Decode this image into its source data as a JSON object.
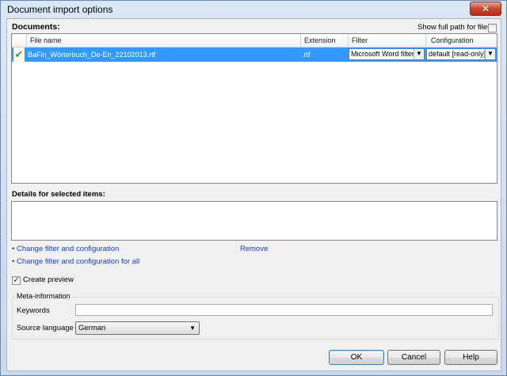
{
  "window": {
    "title": "Document import options",
    "close_glyph": "✕"
  },
  "documents": {
    "heading": "Documents:",
    "show_full_path_label": "Show full path for files",
    "show_full_path_checked": false,
    "columns": [
      "File name",
      "Extension",
      "Filter",
      "Configuration"
    ],
    "rows": [
      {
        "status_icon": "check-icon",
        "status_glyph": "✔",
        "file_name": "BaFin_Wörterbuch_De-En_22102013.rtf",
        "extension": ".rtf",
        "filter": "Microsoft Word filter",
        "configuration": "default [read-only]"
      }
    ]
  },
  "details": {
    "heading": "Details for selected items:"
  },
  "links": {
    "change_filter": "• Change filter and configuration",
    "remove": "Remove",
    "change_filter_all": "• Change filter and configuration for all"
  },
  "preview": {
    "label": "Create preview",
    "checked": true
  },
  "meta": {
    "group_title": "Meta-information",
    "keywords_label": "Keywords",
    "keywords_value": "",
    "source_language_label": "Source language",
    "source_language_value": "German"
  },
  "buttons": {
    "ok": "OK",
    "cancel": "Cancel",
    "help": "Help"
  },
  "glyphs": {
    "dropdown_arrow": "▼",
    "check": "✓"
  },
  "colors": {
    "selection": "#3399ff",
    "link": "#1f3fa8",
    "check_green": "#2aa32a"
  }
}
